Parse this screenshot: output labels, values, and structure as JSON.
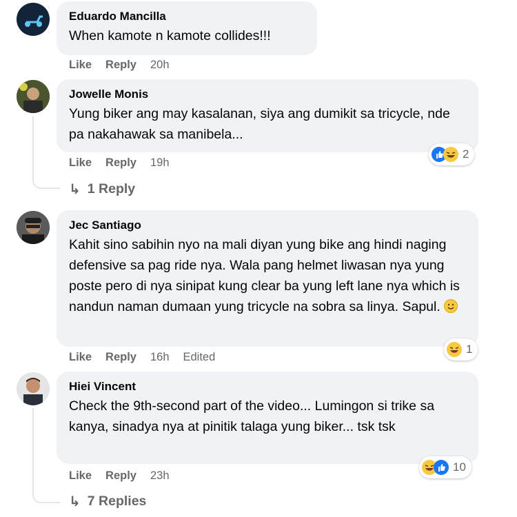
{
  "colors": {
    "bubble": "#f0f2f5",
    "meta": "#65676b",
    "like_blue": "#1877f2",
    "haha_yellow": "#f7c841"
  },
  "comments": [
    {
      "author": "Eduardo Mancilla",
      "text": "When kamote n kamote collides!!!",
      "like": "Like",
      "reply": "Reply",
      "time": "20h",
      "avatar_icon": "scooter-icon"
    },
    {
      "author": "Jowelle Monis",
      "text": "Yung biker ang may kasalanan, siya ang dumikit sa tricycle, nde pa nakahawak sa manibela...",
      "like": "Like",
      "reply": "Reply",
      "time": "19h",
      "reaction_count": "2",
      "reaction_icons": [
        "like-icon",
        "haha-icon"
      ],
      "replies_label": "1 Reply"
    },
    {
      "author": "Jec Santiago",
      "text": "Kahit sino sabihin nyo na mali diyan yung bike ang hindi naging defensive sa pag ride nya. Wala pang helmet liwasan nya yung poste pero di nya sinipat kung clear ba yung left lane nya which is nandun naman dumaan yung tricycle na sobra sa linya. Sapul.",
      "like": "Like",
      "reply": "Reply",
      "time": "16h",
      "edited": "Edited",
      "reaction_count": "1",
      "reaction_icons": [
        "haha-icon"
      ]
    },
    {
      "author": "Hiei Vincent",
      "text": "Check the 9th-second part of the video... Lumingon si trike sa kanya, sinadya nya at pinitik talaga yung biker... tsk tsk",
      "like": "Like",
      "reply": "Reply",
      "time": "23h",
      "reaction_count": "10",
      "reaction_icons": [
        "haha-icon",
        "like-icon"
      ],
      "replies_label": "7 Replies"
    }
  ]
}
